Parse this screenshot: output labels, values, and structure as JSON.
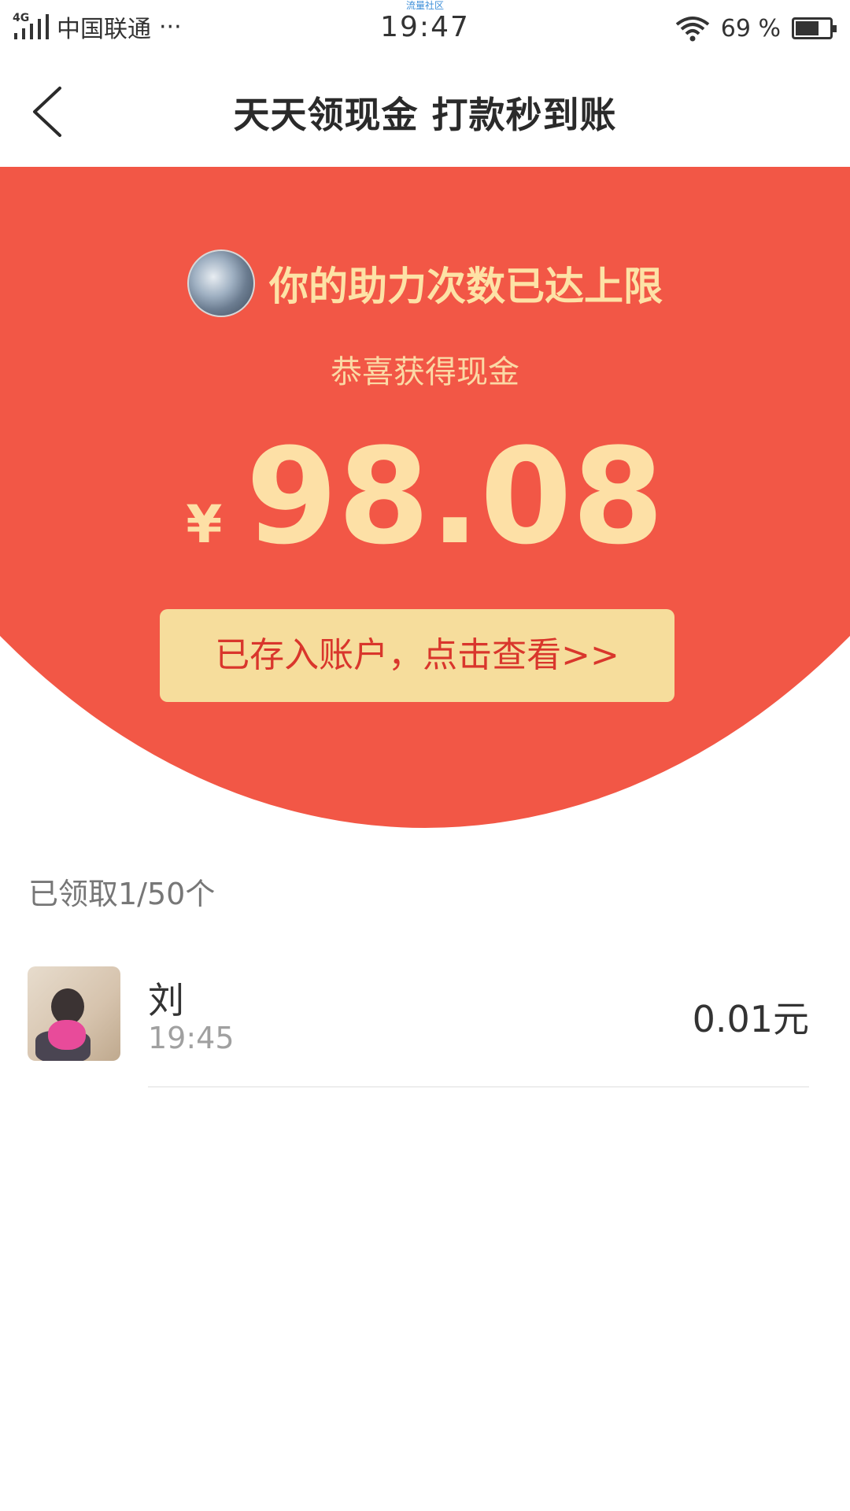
{
  "status_bar": {
    "network": "4G",
    "carrier": "中国联通",
    "more": "···",
    "watermark": "流量社区",
    "time": "19:47",
    "battery": "69 %",
    "battery_level": 0.69
  },
  "header": {
    "title": "天天领现金 打款秒到账",
    "back_icon": "chevron-left-icon"
  },
  "hero": {
    "status": "你的助力次数已达上限",
    "congrats": "恭喜获得现金",
    "currency": "¥",
    "amount": "98.08",
    "cta": "已存入账户，点击查看>>",
    "colors": {
      "background": "#f25746",
      "gold_text": "#fde0a6",
      "button_bg": "#f6dd9c",
      "button_text": "#d9362c"
    }
  },
  "list": {
    "summary": "已领取1/50个",
    "items": [
      {
        "name": "刘",
        "time": "19:45",
        "amount": "0.01元"
      }
    ]
  }
}
